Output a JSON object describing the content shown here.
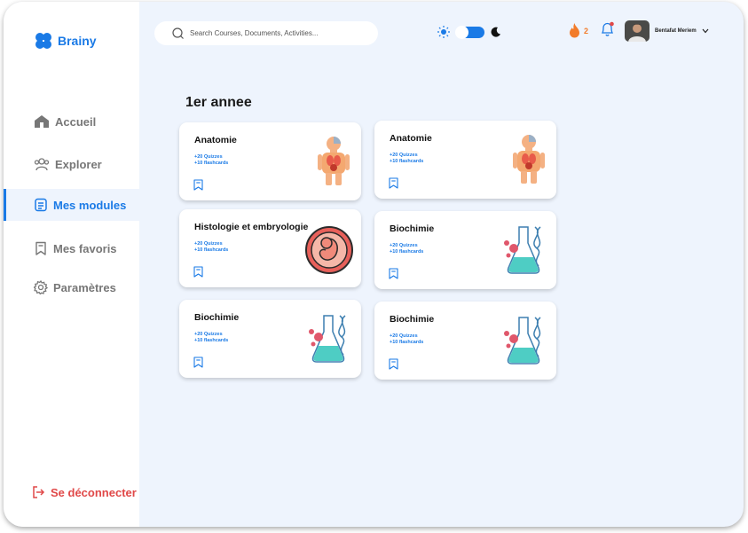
{
  "app": {
    "name": "Brainy"
  },
  "sidebar": {
    "items": [
      {
        "label": "Accueil",
        "icon": "home-icon",
        "active": false
      },
      {
        "label": "Explorer",
        "icon": "users-icon",
        "active": false
      },
      {
        "label": "Mes modules",
        "icon": "document-icon",
        "active": true
      },
      {
        "label": "Mes favoris",
        "icon": "bookmark-icon",
        "active": false
      },
      {
        "label": "Paramètres",
        "icon": "gear-icon",
        "active": false
      }
    ],
    "logout_label": "Se déconnecter"
  },
  "header": {
    "search_placeholder": "Search Courses, Documents, Activities...",
    "streak_count": "2",
    "user_name": "Bentafat Meriem",
    "theme_mode": "light"
  },
  "main": {
    "title": "1er annee",
    "modules": [
      {
        "title": "Anatomie",
        "quizzes": "+20 Quizzes",
        "flashcards": "+10 flashcards",
        "illustration": "anatomy-illustration"
      },
      {
        "title": "Anatomie",
        "quizzes": "+20 Quizzes",
        "flashcards": "+10 flashcards",
        "illustration": "anatomy-illustration"
      },
      {
        "title": "Histologie et embryologie",
        "quizzes": "+20 Quizzes",
        "flashcards": "+10 flashcards",
        "illustration": "embryo-illustration"
      },
      {
        "title": "Biochimie",
        "quizzes": "+20 Quizzes",
        "flashcards": "+10 flashcards",
        "illustration": "chemistry-illustration"
      },
      {
        "title": "Biochimie",
        "quizzes": "+20 Quizzes",
        "flashcards": "+10 flashcards",
        "illustration": "chemistry-illustration"
      },
      {
        "title": "Biochimie",
        "quizzes": "+20 Quizzes",
        "flashcards": "+10 flashcards",
        "illustration": "chemistry-illustration"
      }
    ]
  },
  "colors": {
    "accent": "#1a7ae6",
    "danger": "#e04848",
    "streak": "#f27b2a",
    "background": "#eef4fd"
  }
}
